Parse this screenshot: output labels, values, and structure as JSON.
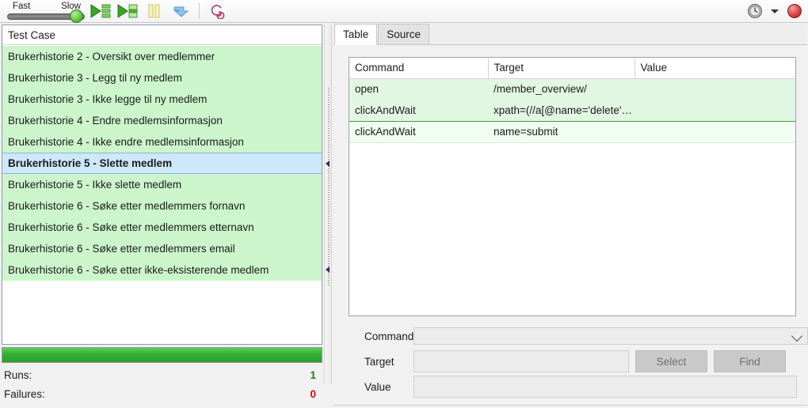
{
  "toolbar": {
    "speed": {
      "fast_label": "Fast",
      "slow_label": "Slow",
      "position": "slow"
    },
    "buttons": [
      {
        "name": "run-all-tests-button",
        "icon": "play-all-icon",
        "title": "Run all test cases"
      },
      {
        "name": "run-current-test-button",
        "icon": "play-single-icon",
        "title": "Run current test case"
      },
      {
        "name": "pause-resume-button",
        "icon": "pause-icon",
        "title": "Pause / Resume"
      },
      {
        "name": "step-button",
        "icon": "step-arrow-icon",
        "title": "Step"
      },
      {
        "name": "rollup-button",
        "icon": "spiral-icon",
        "title": "Apply rollup rules"
      }
    ],
    "right_buttons": [
      {
        "name": "schedule-clock-button",
        "icon": "clock-icon",
        "title": "Clock"
      },
      {
        "name": "clock-dropdown-button",
        "icon": "chevron-down-icon",
        "title": "Options"
      },
      {
        "name": "record-button",
        "icon": "record-dot-icon",
        "title": "Record"
      }
    ]
  },
  "suite": {
    "header": "Test Case",
    "cases": [
      {
        "label": "Brukerhistorie 2 - Oversikt over medlemmer",
        "state": "pass",
        "selected": false
      },
      {
        "label": "Brukerhistorie 3 - Legg til ny medlem",
        "state": "pass",
        "selected": false
      },
      {
        "label": "Brukerhistorie 3 - Ikke legge til ny medlem",
        "state": "pass",
        "selected": false
      },
      {
        "label": "Brukerhistorie 4 - Endre medlemsinformasjon",
        "state": "pass",
        "selected": false
      },
      {
        "label": "Brukerhistorie 4 - Ikke endre medlemsinformasjon",
        "state": "pass",
        "selected": false
      },
      {
        "label": "Brukerhistorie 5 - Slette medlem",
        "state": "running",
        "selected": true
      },
      {
        "label": "Brukerhistorie 5 - Ikke slette medlem",
        "state": "pass",
        "selected": false
      },
      {
        "label": "Brukerhistorie 6 - Søke etter medlemmers fornavn",
        "state": "pass",
        "selected": false
      },
      {
        "label": "Brukerhistorie 6 - Søke etter medlemmers etternavn",
        "state": "pass",
        "selected": false
      },
      {
        "label": "Brukerhistorie 6 - Søke etter medlemmers email",
        "state": "pass",
        "selected": false
      },
      {
        "label": "Brukerhistorie 6 - Søke etter ikke-eksisterende medlem",
        "state": "pass",
        "selected": false
      }
    ],
    "progress_percent": 100,
    "stats": {
      "runs_label": "Runs:",
      "runs_value": "1",
      "failures_label": "Failures:",
      "failures_value": "0"
    }
  },
  "editor": {
    "tabs": [
      {
        "label": "Table",
        "active": true
      },
      {
        "label": "Source",
        "active": false
      }
    ],
    "table": {
      "columns": [
        "Command",
        "Target",
        "Value"
      ],
      "rows": [
        {
          "command": "open",
          "target": "/member_overview/",
          "value": "",
          "state": "pass"
        },
        {
          "command": "clickAndWait",
          "target": "xpath=(//a[@name='delete'…",
          "value": "",
          "state": "pass"
        },
        {
          "command": "clickAndWait",
          "target": "name=submit",
          "value": "",
          "state": "current"
        }
      ]
    },
    "form": {
      "command_label": "Command",
      "command_value": "",
      "target_label": "Target",
      "target_value": "",
      "value_label": "Value",
      "value_value": "",
      "select_button": "Select",
      "find_button": "Find"
    }
  },
  "colors": {
    "pass_green": "#e2f7e2",
    "list_green": "#ccf5cc",
    "selection_blue": "#cde8fb",
    "progress_green": "#34ad34",
    "runs_text": "#1f7a1f",
    "failures_text": "#c01212",
    "record_red": "#d64040"
  }
}
